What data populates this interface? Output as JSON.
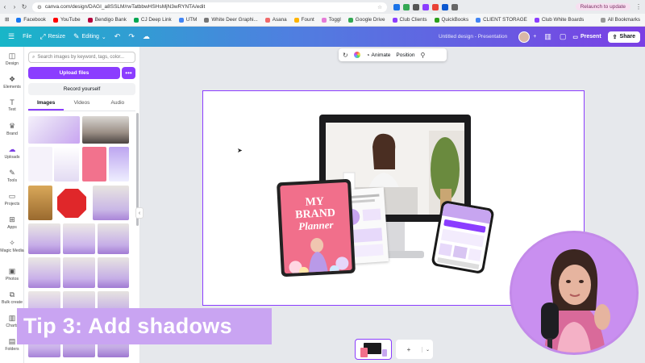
{
  "browser": {
    "url": "canva.com/design/DAGI_a8SSLM/rwTatbbwHSHsMjN3wRYNTA/edit",
    "relaunch_label": "Relaunch to update",
    "bookmarks": [
      {
        "label": "Facebook",
        "color": "#1877f2"
      },
      {
        "label": "YouTube",
        "color": "#ff0000"
      },
      {
        "label": "Bendigo Bank",
        "color": "#b4003c"
      },
      {
        "label": "CJ Deep Link",
        "color": "#00a651"
      },
      {
        "label": "UTM",
        "color": "#4285f4"
      },
      {
        "label": "White Deer Graphi...",
        "color": "#777777"
      },
      {
        "label": "Asana",
        "color": "#f06a6a"
      },
      {
        "label": "Fount",
        "color": "#ffb400"
      },
      {
        "label": "Toggl",
        "color": "#e57cd8"
      },
      {
        "label": "Google Drive",
        "color": "#34a853"
      },
      {
        "label": "Club Clients",
        "color": "#8b3dff"
      },
      {
        "label": "QuickBooks",
        "color": "#2ca01c"
      },
      {
        "label": "CLIENT STORAGE",
        "color": "#4285f4"
      },
      {
        "label": "Club White Boards",
        "color": "#8b3dff"
      }
    ],
    "all_bookmarks": "All Bookmarks"
  },
  "topbar": {
    "file": "File",
    "resize": "Resize",
    "editing": "Editing",
    "title": "Untitled design - Presentation",
    "present": "Present",
    "share": "Share"
  },
  "rail": [
    {
      "label": "Design",
      "icon": "◫"
    },
    {
      "label": "Elements",
      "icon": "❖"
    },
    {
      "label": "Text",
      "icon": "T"
    },
    {
      "label": "Brand",
      "icon": "♛"
    },
    {
      "label": "Uploads",
      "icon": "☁"
    },
    {
      "label": "Tools",
      "icon": "✎"
    },
    {
      "label": "Projects",
      "icon": "▭"
    },
    {
      "label": "Apps",
      "icon": "⊞"
    },
    {
      "label": "Magic Media",
      "icon": "✧"
    },
    {
      "label": "Photos",
      "icon": "▣"
    },
    {
      "label": "Bulk create",
      "icon": "⧉"
    },
    {
      "label": "Charts",
      "icon": "▥"
    },
    {
      "label": "Folders",
      "icon": "▤"
    }
  ],
  "panel": {
    "search_placeholder": "Search images by keyword, tags, color...",
    "upload_label": "Upload files",
    "more_label": "•••",
    "record_label": "Record yourself",
    "tabs": [
      "Images",
      "Videos",
      "Audio"
    ]
  },
  "context_bar": {
    "animate": "Animate",
    "position": "Position"
  },
  "mockup": {
    "tablet_line1": "MY",
    "tablet_line2": "BRAND",
    "tablet_line3": "Planner"
  },
  "caption": "Tip 3: Add shadows",
  "colors": {
    "accent": "#8b3dff",
    "caption_bg": "#c9a4f2",
    "topbar_start": "#18b6c8",
    "topbar_end": "#7b3fe4"
  }
}
